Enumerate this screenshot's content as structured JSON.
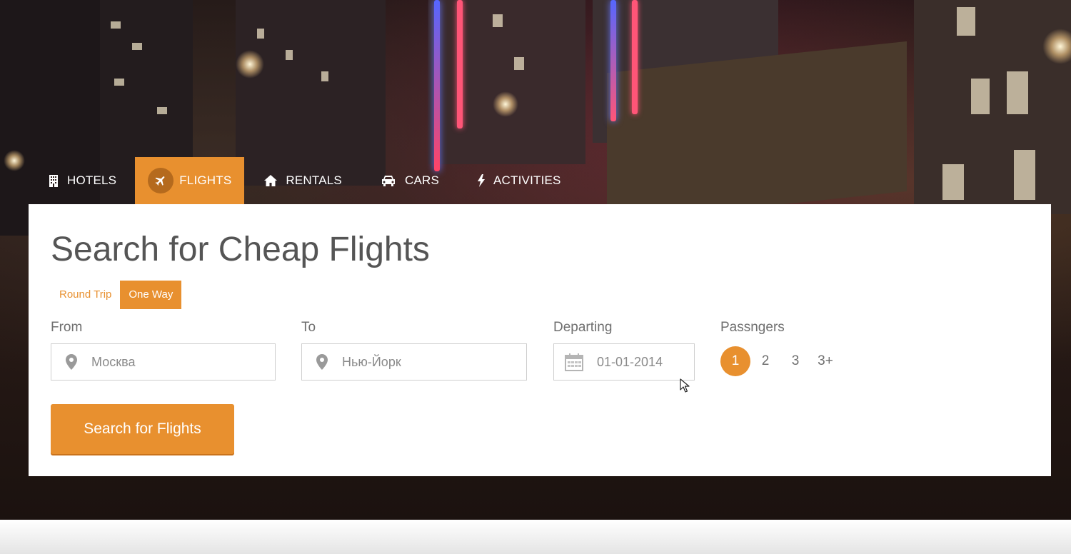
{
  "tabs": [
    {
      "label": "HOTELS",
      "icon": "building-icon"
    },
    {
      "label": "FLIGHTS",
      "icon": "plane-icon",
      "active": true
    },
    {
      "label": "RENTALS",
      "icon": "home-icon"
    },
    {
      "label": "CARS",
      "icon": "car-icon"
    },
    {
      "label": "ACTIVITIES",
      "icon": "bolt-icon"
    }
  ],
  "panel": {
    "title": "Search for Cheap Flights",
    "trip_types": [
      "Round Trip",
      "One Way"
    ],
    "selected_trip_type": "One Way",
    "from": {
      "label": "From",
      "value": "Москва"
    },
    "to": {
      "label": "To",
      "value": "Нью-Йорк"
    },
    "departing": {
      "label": "Departing",
      "value": "01-01-2014"
    },
    "passengers": {
      "label": "Passngers",
      "options": [
        "1",
        "2",
        "3",
        "3+"
      ],
      "selected": "1"
    },
    "search_button": "Search for Flights"
  },
  "colors": {
    "accent": "#e8902f",
    "text": "#555555",
    "muted": "#8a8a8a"
  }
}
